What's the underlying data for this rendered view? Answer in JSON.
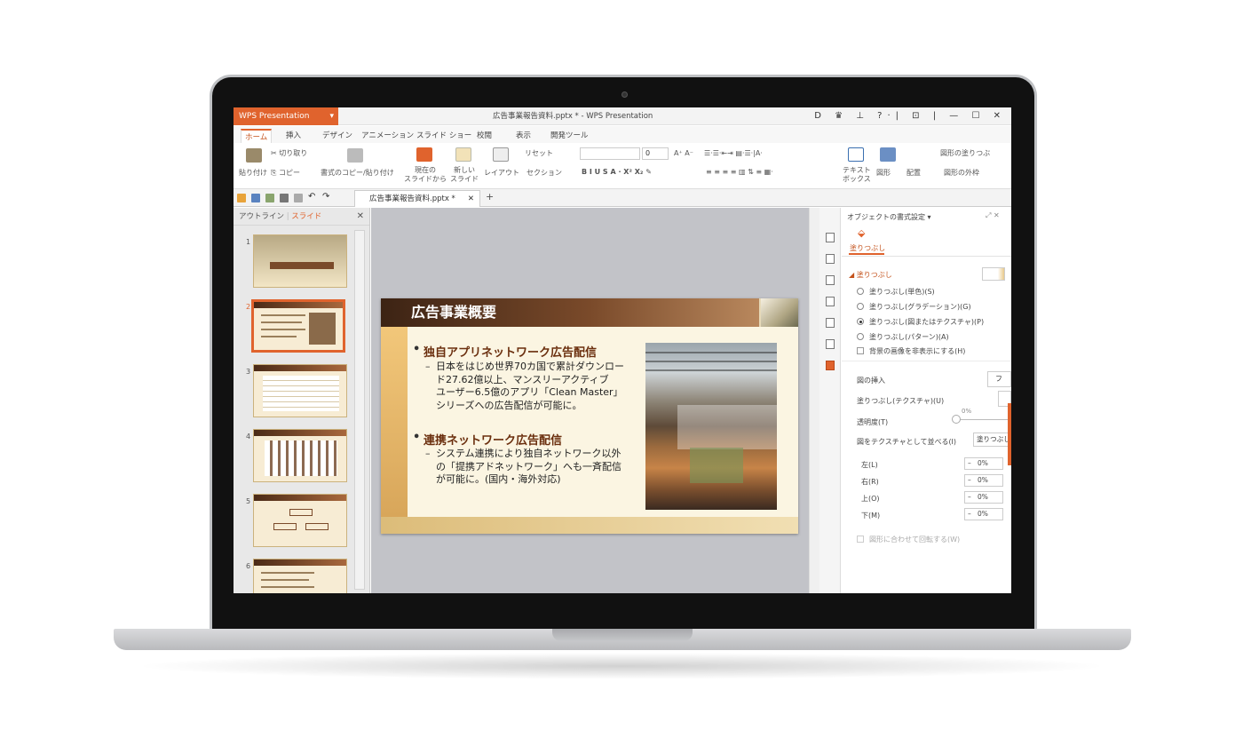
{
  "window": {
    "app_button": "WPS Presentation",
    "title": "広告事業報告資料.pptx * - WPS Presentation",
    "controls": "D ♛ ⊥ ?·| ⊡ | — ☐ ✕"
  },
  "tabs": [
    "ホーム",
    "挿入",
    "デザイン",
    "アニメーション",
    "スライド ショー",
    "校閲",
    "表示",
    "開発ツール"
  ],
  "ribbon": {
    "paste": "貼り付け",
    "cut": "切り取り",
    "copy": "コピー",
    "format_painter": "書式のコピー/貼り付け",
    "from_current": "現在の\nスライドから",
    "new_slide": "新しい\nスライド",
    "layout": "レイアウト",
    "reset": "リセット",
    "section": "セクション",
    "font_size": "0",
    "format_row": "B  I  U  S  A · X²  X₂  ✎",
    "textbox": "テキスト\nボックス",
    "shape": "図形",
    "arrange": "配置",
    "shape_fill": "図形の塗りつぶ",
    "shape_outline": "図形の外枠"
  },
  "doc_tab": {
    "label": "広告事業報告資料.pptx *",
    "close": "✕",
    "add": "+"
  },
  "left_panel": {
    "outline": "アウトライン",
    "slides": "スライド",
    "close": "✕",
    "thumb_nums": [
      "1",
      "2",
      "3",
      "4",
      "5",
      "6"
    ]
  },
  "slide": {
    "title": "広告事業概要",
    "bullet1": "独自アプリネットワーク広告配信",
    "sub1": "日本をはじめ世界70カ国で累計ダウンロー\nド27.62億以上、マンスリーアクティブ\nユーザー6.5億のアプリ「Clean Master」\nシリーズへの広告配信が可能に。",
    "bullet2": "連携ネットワーク広告配信",
    "sub2": "システム連携により独自ネットワーク以外\nの「提携アドネットワーク」へも一斉配信\nが可能に。(国内・海外対応)",
    "dash": "–"
  },
  "right_panel": {
    "title": "オブジェクトの書式設定 ▾",
    "tab": "塗りつぶし",
    "section": "塗りつぶし",
    "radio_solid": "塗りつぶし(単色)(S)",
    "radio_gradient": "塗りつぶし(グラデーション)(G)",
    "radio_picture": "塗りつぶし(図またはテクスチャ)(P)",
    "radio_pattern": "塗りつぶし(パターン)(A)",
    "hide_bg": "背景の画像を非表示にする(H)",
    "insert_picture": "図の挿入",
    "insert_btn": "フ",
    "texture_fill": "塗りつぶし(テクスチャ)(U)",
    "transparency": "透明度(T)",
    "transparency_val": "0%",
    "tile": "図をテクスチャとして並べる(I)",
    "tile_val": "塗りつぶし",
    "left": "左(L)",
    "right": "右(R)",
    "top": "上(O)",
    "bottom": "下(M)",
    "offset_val": "0%",
    "rotate": "図形に合わせて回転する(W)"
  },
  "colors": {
    "accent": "#e0632d",
    "slide_dark": "#3c2314"
  }
}
